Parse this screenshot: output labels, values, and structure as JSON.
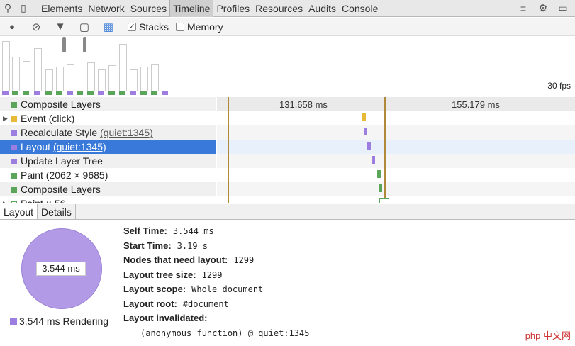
{
  "tabs": [
    "Elements",
    "Network",
    "Sources",
    "Timeline",
    "Profiles",
    "Resources",
    "Audits",
    "Console"
  ],
  "toolbar": {
    "stacks_label": "Stacks",
    "memory_label": "Memory",
    "stacks_checked": true,
    "memory_checked": false
  },
  "overview": {
    "fps_label": "30 fps"
  },
  "records": [
    {
      "label": "Composite Layers",
      "link": "",
      "color": "#5ba55b",
      "expander": false
    },
    {
      "label": "Event (click)",
      "link": "",
      "color": "#e8b937",
      "expander": true
    },
    {
      "label": "Recalculate Style ",
      "link": "(quiet:1345)",
      "color": "#9c7ee0",
      "expander": false
    },
    {
      "label": "Layout ",
      "link": "(quiet:1345)",
      "color": "#9c7ee0",
      "expander": false,
      "selected": true
    },
    {
      "label": "Update Layer Tree",
      "link": "",
      "color": "#9c7ee0",
      "expander": false
    },
    {
      "label": "Paint (2062 × 9685)",
      "link": "",
      "color": "#5ba55b",
      "expander": false
    },
    {
      "label": "Composite Layers",
      "link": "",
      "color": "#5ba55b",
      "expander": false
    },
    {
      "label": "Paint × 56",
      "link": "",
      "color": "#ffffff",
      "expander": true
    }
  ],
  "ruler": {
    "marker1": "131.658 ms",
    "marker2": "155.179 ms"
  },
  "detail_tabs": [
    "Layout",
    "Details"
  ],
  "pie": {
    "label": "3.544 ms",
    "legend": "3.544 ms Rendering"
  },
  "details": {
    "self_time_label": "Self Time:",
    "self_time": "3.544 ms",
    "start_time_label": "Start Time:",
    "start_time": "3.19 s",
    "nodes_label": "Nodes that need layout:",
    "nodes": "1299",
    "tree_size_label": "Layout tree size:",
    "tree_size": "1299",
    "scope_label": "Layout scope:",
    "scope": "Whole document",
    "root_label": "Layout root:",
    "root": "#document",
    "invalidated_label": "Layout invalidated:",
    "invalidated_fn": "(anonymous function) @ ",
    "invalidated_link": "quiet:1345"
  },
  "colors": {
    "loading": "#5b8be0",
    "scripting": "#e8b937",
    "rendering": "#9c7ee0",
    "painting": "#5ba55b",
    "selection": "#3879d9"
  },
  "logo": {
    "text": "php 中文网"
  }
}
